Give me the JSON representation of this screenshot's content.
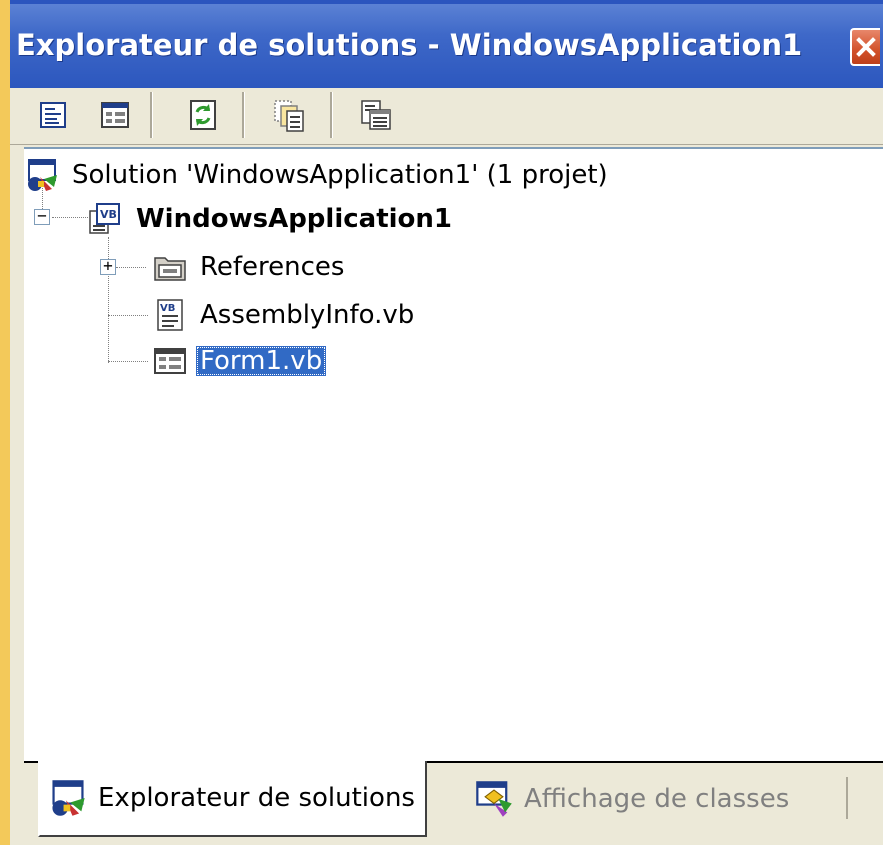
{
  "window": {
    "title": "Explorateur de solutions - WindowsApplication1",
    "close_icon": "close-icon"
  },
  "toolbar": {
    "buttons": [
      {
        "name": "properties",
        "icon": "properties-icon"
      },
      {
        "name": "view-designer",
        "icon": "designer-icon"
      },
      {
        "name": "refresh",
        "icon": "refresh-icon"
      },
      {
        "name": "show-all-files",
        "icon": "show-all-files-icon"
      },
      {
        "name": "view-code",
        "icon": "view-code-icon"
      }
    ]
  },
  "tree": {
    "solution_label": "Solution 'WindowsApplication1' (1 projet)",
    "project_label": "WindowsApplication1",
    "references_label": "References",
    "assemblyinfo_label": "AssemblyInfo.vb",
    "form1_label": "Form1.vb",
    "collapse_glyph": "−",
    "expand_glyph": "+"
  },
  "tabs": {
    "solution_explorer": "Explorateur de solutions",
    "class_view": "Affichage de classes"
  },
  "colors": {
    "titlebar": "#2C57BE",
    "selection": "#316AC5",
    "close": "#D2512A",
    "panel": "#ECE9D8"
  }
}
